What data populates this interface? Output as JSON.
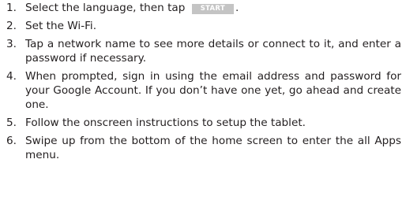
{
  "steps": [
    {
      "number": "1.",
      "text_before": "Select the language, then tap",
      "button_label": "START",
      "text_after": "."
    },
    {
      "number": "2.",
      "text": "Set the Wi-Fi."
    },
    {
      "number": "3.",
      "text": "Tap a network name to see more details or connect to it, and enter a password if necessary."
    },
    {
      "number": "4.",
      "text": "When prompted, sign in using the email address and password for your Google Account. If you don’t have one yet, go ahead and create one."
    },
    {
      "number": "5.",
      "text": "Follow the onscreen instructions to setup the tablet."
    },
    {
      "number": "6.",
      "text": "Swipe up from the bottom of the home screen to enter the all Apps menu."
    }
  ],
  "colors": {
    "text": "#231f20",
    "button_bg": "#c4c4c4",
    "button_text": "#ffffff"
  }
}
